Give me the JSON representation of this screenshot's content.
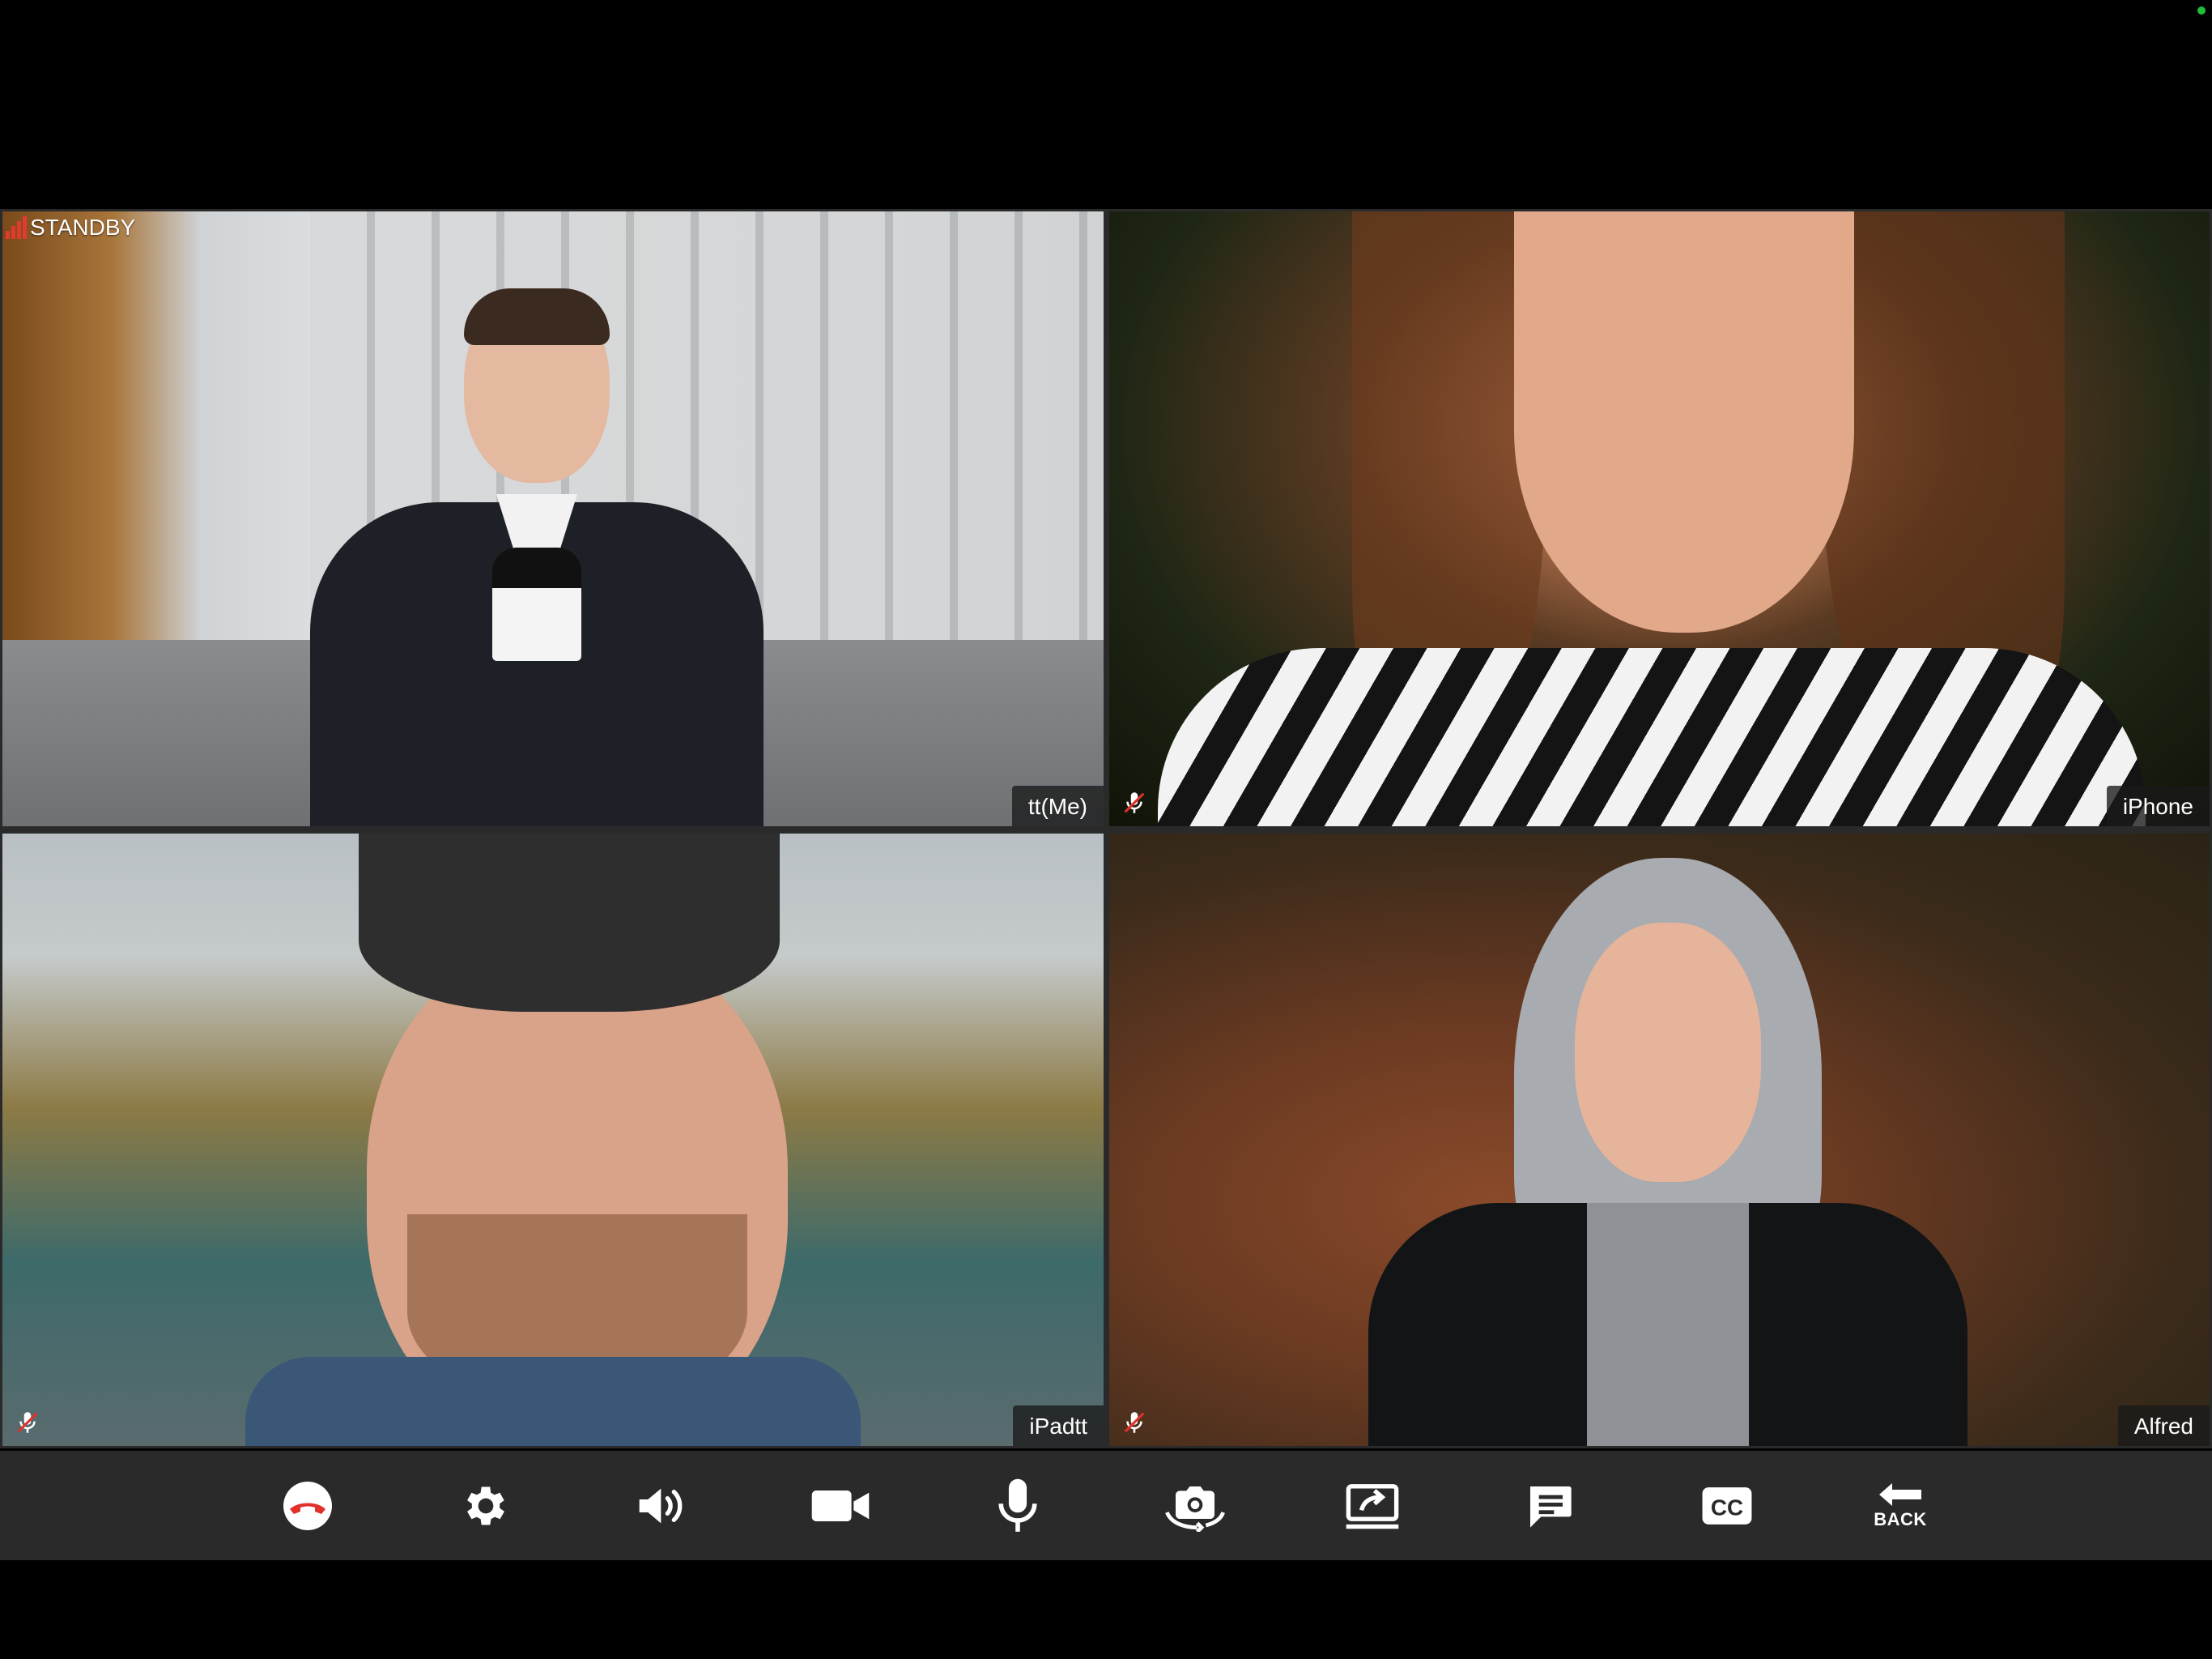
{
  "app": {
    "status_dot_color": "#1fbf3a"
  },
  "tiles": [
    {
      "name": "tt(Me)",
      "muted": false,
      "badge": "STANDBY",
      "badge_color": "#e23b2e"
    },
    {
      "name": "iPhone",
      "muted": true
    },
    {
      "name": "iPadtt",
      "muted": true
    },
    {
      "name": "Alfred",
      "muted": true
    }
  ],
  "toolbar": {
    "buttons": [
      {
        "id": "end-call",
        "icon": "phone-hangup-icon",
        "color": "#e0312b"
      },
      {
        "id": "settings",
        "icon": "gear-icon"
      },
      {
        "id": "speaker",
        "icon": "speaker-icon"
      },
      {
        "id": "camera",
        "icon": "video-camera-icon"
      },
      {
        "id": "microphone",
        "icon": "microphone-icon"
      },
      {
        "id": "switch-camera",
        "icon": "switch-camera-icon"
      },
      {
        "id": "share-screen",
        "icon": "share-screen-icon"
      },
      {
        "id": "chat",
        "icon": "chat-icon"
      },
      {
        "id": "captions",
        "icon": "closed-captions-icon",
        "label": "CC"
      },
      {
        "id": "back",
        "icon": "back-arrow-icon",
        "label": "BACK"
      }
    ]
  }
}
